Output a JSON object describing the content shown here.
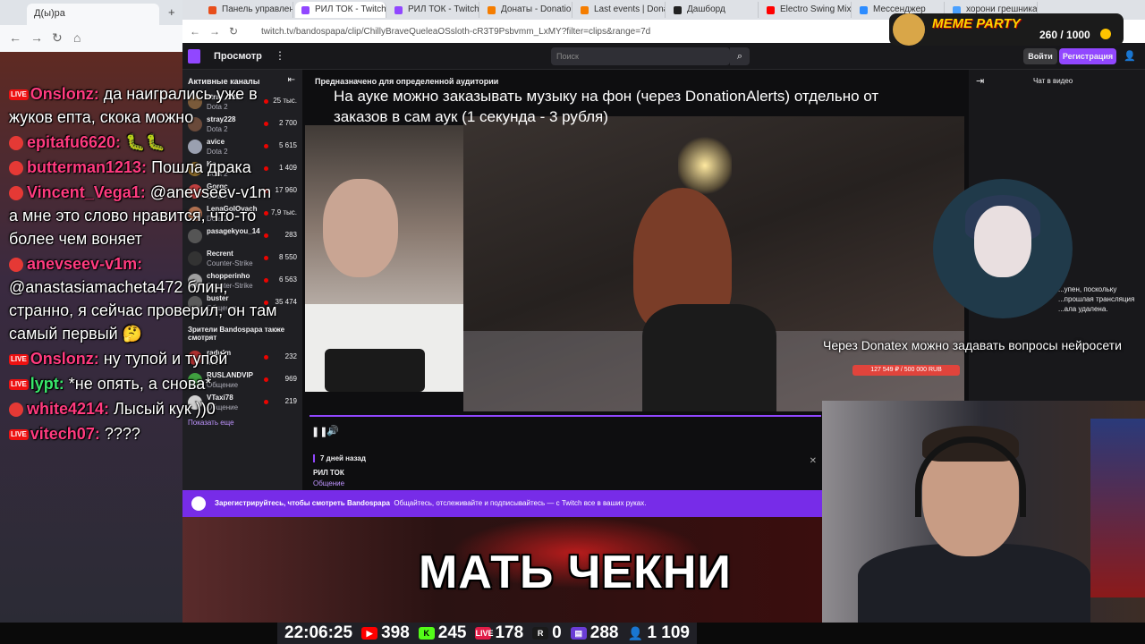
{
  "left_browser": {
    "tab_title": "Д(ы)ра",
    "new_tab_symbol": "+"
  },
  "tabs": [
    {
      "label": "Панель управлени",
      "color": "#e84e1b",
      "active": false
    },
    {
      "label": "РИЛ ТОК - Twitch",
      "color": "#9147ff",
      "active": true
    },
    {
      "label": "РИЛ ТОК - Twitch",
      "color": "#9147ff",
      "active": false
    },
    {
      "label": "Донаты - DonationAl",
      "color": "#f57d00",
      "active": false
    },
    {
      "label": "Last events | Donati",
      "color": "#f57d00",
      "active": false
    },
    {
      "label": "Дашборд",
      "color": "#222222",
      "active": false
    },
    {
      "label": "Electro Swing Mix - E",
      "color": "#ff0000",
      "active": false
    },
    {
      "label": "Мессенджер",
      "color": "#2d8cff",
      "active": false
    },
    {
      "label": "хорони грешника",
      "color": "#4aa0ff",
      "active": false
    }
  ],
  "url": "twitch.tv/bandospapa/clip/ChillyBraveQueleaOSsloth-cR3T9Psbvmm_LxMY?filter=clips&range=7d",
  "twitch": {
    "browse": "Просмотр",
    "search_placeholder": "Поиск",
    "login": "Войти",
    "signup": "Регистрация",
    "sidebar_title": "Активные каналы",
    "channels": [
      {
        "name": "stray_228",
        "game": "Dota 2",
        "viewers": "25 тыс.",
        "color": "#7a5a3a"
      },
      {
        "name": "stray228",
        "game": "Dota 2",
        "viewers": "2 700",
        "color": "#6a4a3a"
      },
      {
        "name": "avice",
        "game": "Dota 2",
        "viewers": "5 615",
        "color": "#9aa0b0"
      },
      {
        "name": "Ko...",
        "game": "Dota 2",
        "viewers": "1 409",
        "color": "#8a6a2a"
      },
      {
        "name": "Gorgc",
        "game": "Dota 2",
        "viewers": "17 960",
        "color": "#c04040"
      },
      {
        "name": "LenaGolOvach",
        "game": "Dota 2",
        "viewers": "7,9 тыс.",
        "color": "#b07050"
      },
      {
        "name": "pasagekyou_14",
        "game": "",
        "viewers": "283",
        "color": "#555555"
      },
      {
        "name": "Recrent",
        "game": "Counter-Strike",
        "viewers": "8 550",
        "color": "#333333"
      },
      {
        "name": "chopperinho",
        "game": "Counter-Strike",
        "viewers": "6 563",
        "color": "#a0a0a0"
      },
      {
        "name": "buster",
        "game": "Общение",
        "viewers": "35 474",
        "color": "#5a5a5a"
      }
    ],
    "also_watch": "Зрители Bandospapa также смотрят",
    "channels2": [
      {
        "name": "radufm",
        "game": "IRL",
        "viewers": "232",
        "color": "#b03030"
      },
      {
        "name": "RUSLANDVIP",
        "game": "Общение",
        "viewers": "969",
        "color": "#40a040"
      },
      {
        "name": "VTaxi78",
        "game": "Общение",
        "viewers": "219",
        "color": "#d0d0d0"
      }
    ],
    "show_more": "Показать еще",
    "audience_label": "Предназначено для определенной аудитории",
    "clip_age": "7 дней назад",
    "clip_title": "РИЛ ТОК",
    "clip_category": "Общение",
    "signup_banner_name": "Зарегистрируйтесь, чтобы смотреть Bandospapa",
    "signup_banner_rest": "Общайтесь, отслеживайте и подписывайтесь — с Twitch все в ваших руках.",
    "chat_title": "Чат в видео",
    "chat_note": "...упен, поскольку ...прошлая трансляция ...ала удалена.",
    "donation_bar": "127 549 ₽ / 500 000 RUB"
  },
  "overlay_message": "На ауке можно заказывать музыку на фон (через DonationAlerts) отдельно от заказов в сам аук (1 секунда - 3 рубля)",
  "donatex_message": "Через Donatex можно задавать вопросы нейросети",
  "meme_caption": "МАТЬ ЧЕКНИ",
  "meme_party": {
    "title": "MEME PARTY",
    "count": "260 / 1000"
  },
  "chat": [
    {
      "badge": "LIVE",
      "user": "Onslonz:",
      "user_color": "pink",
      "text": "да наигрались уже в жуков епта, скока можно"
    },
    {
      "badge": "",
      "user": "epitafu6620:",
      "user_color": "pink",
      "text": "🐛🐛"
    },
    {
      "badge": "",
      "user": "butterman1213:",
      "user_color": "pink",
      "text": "Пошла драка"
    },
    {
      "badge": "",
      "user": "Vincent_Vega1:",
      "user_color": "pink",
      "text": "@anevseev-v1m а мне это слово нравится, что-то более чем воняет"
    },
    {
      "badge": "",
      "user": "anevseev-v1m:",
      "user_color": "pink",
      "text": "@anastasiamacheta472 блин, странно, я сейчас проверил, он там самый первый 🤔"
    },
    {
      "badge": "LIVE",
      "user": "Onslonz:",
      "user_color": "pink",
      "text": "ну тупой и тупой"
    },
    {
      "badge": "LIVE",
      "user": "lypt:",
      "user_color": "green",
      "text": "*не опять, а снова*"
    },
    {
      "badge": "",
      "user": "white4214:",
      "user_color": "pink",
      "text": "Лысый кук ))0"
    },
    {
      "badge": "LIVE",
      "user": "vitech07:",
      "user_color": "pink",
      "text": "????"
    }
  ],
  "stats": {
    "time": "22:06:25",
    "youtube": "398",
    "kick": "245",
    "vklive": "178",
    "rutube": "0",
    "trovo": "288",
    "total": "1 109",
    "colors": {
      "youtube": "#ff0000",
      "kick": "#53fc18",
      "vklive": "#e11d48",
      "rutube": "#1a1a1a",
      "trovo": "#6a3dd6",
      "total": "#4aa0ff"
    }
  }
}
